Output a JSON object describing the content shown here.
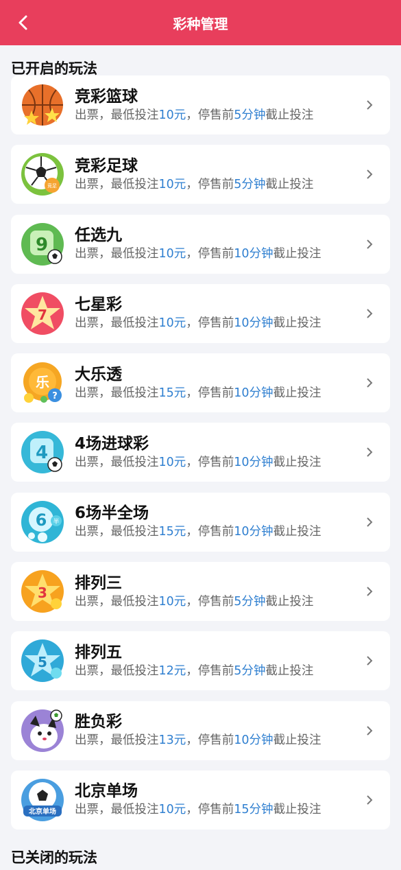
{
  "header": {
    "title": "彩种管理"
  },
  "sections": {
    "open_title": "已开启的玩法",
    "closed_title": "已关闭的玩法"
  },
  "colors": {
    "header_bg": "#e83e5c",
    "highlight": "#2f7fd0",
    "page_bg": "#f3f4f8"
  },
  "text": {
    "prefix": "出票，最低投注",
    "middle": "，停售前",
    "suffix": "截止投注"
  },
  "games": [
    {
      "name": "竞彩篮球",
      "min": "10元",
      "cutoff": "5分钟",
      "icon": "basketball-icon"
    },
    {
      "name": "竞彩足球",
      "min": "10元",
      "cutoff": "5分钟",
      "icon": "football-icon"
    },
    {
      "name": "任选九",
      "min": "10元",
      "cutoff": "10分钟",
      "icon": "number-nine-icon"
    },
    {
      "name": "七星彩",
      "min": "10元",
      "cutoff": "10分钟",
      "icon": "seven-star-icon"
    },
    {
      "name": "大乐透",
      "min": "15元",
      "cutoff": "10分钟",
      "icon": "lottery-ball-icon"
    },
    {
      "name": "4场进球彩",
      "min": "10元",
      "cutoff": "10分钟",
      "icon": "number-four-icon"
    },
    {
      "name": "6场半全场",
      "min": "15元",
      "cutoff": "10分钟",
      "icon": "number-six-icon"
    },
    {
      "name": "排列三",
      "min": "10元",
      "cutoff": "5分钟",
      "icon": "number-three-star-icon"
    },
    {
      "name": "排列五",
      "min": "12元",
      "cutoff": "5分钟",
      "icon": "number-five-star-icon"
    },
    {
      "name": "胜负彩",
      "min": "13元",
      "cutoff": "10分钟",
      "icon": "dog-mascot-icon"
    },
    {
      "name": "北京单场",
      "min": "10元",
      "cutoff": "15分钟",
      "icon": "beijing-football-icon"
    }
  ]
}
